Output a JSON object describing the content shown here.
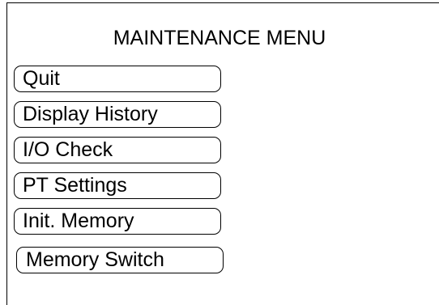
{
  "menu": {
    "title": "MAINTENANCE MENU",
    "items": [
      {
        "label": "Quit"
      },
      {
        "label": "Display History"
      },
      {
        "label": "I/O Check"
      },
      {
        "label": "PT Settings"
      },
      {
        "label": "Init. Memory"
      },
      {
        "label": "Memory Switch"
      }
    ]
  }
}
